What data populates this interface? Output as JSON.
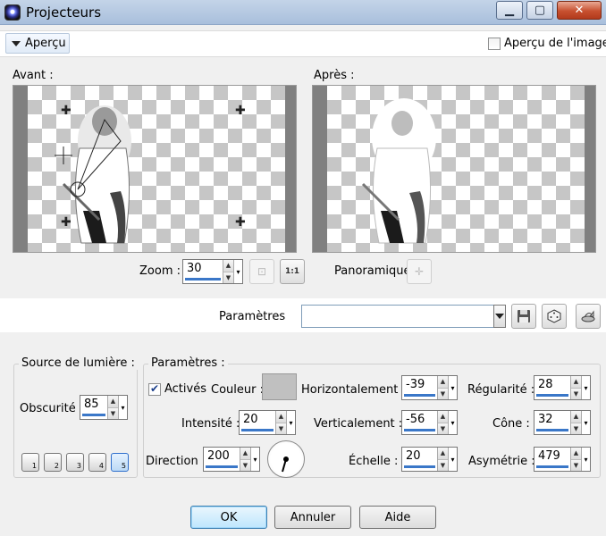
{
  "window": {
    "title": "Projecteurs",
    "minimize_glyph": "▁",
    "maximize_glyph": "▢",
    "close_glyph": "✕"
  },
  "preview": {
    "toggle_label": "Aperçu",
    "image_preview_label": "Aperçu de l'image",
    "image_preview_checked": false,
    "before_label": "Avant :",
    "after_label": "Après :",
    "zoom_label": "Zoom :",
    "zoom_value": "30",
    "zoom_fit_icon": "fit-to-window-icon",
    "zoom_fit_glyph": "⊡",
    "zoom_1to1_label": "1:1",
    "pan_label": "Panoramique",
    "pan_glyph": "✛",
    "handle_glyph": "✚"
  },
  "presets": {
    "label": "Paramètres",
    "value": "",
    "save_icon": "floppy-disk-icon",
    "random_icon": "dice-icon",
    "reset_icon": "reset-icon"
  },
  "light_source": {
    "group_title": "Source de lumière :",
    "darkness_label": "Obscurité :",
    "darkness_value": "85",
    "lights": [
      {
        "label": "1",
        "selected": false
      },
      {
        "label": "2",
        "selected": false
      },
      {
        "label": "3",
        "selected": false
      },
      {
        "label": "4",
        "selected": false
      },
      {
        "label": "5",
        "selected": true
      }
    ]
  },
  "params": {
    "group_title": "Paramètres :",
    "active_label": "Activés",
    "active_checked": true,
    "color_label": "Couleur :",
    "color_value": "#c0c0c0",
    "intensity_label": "Intensité :",
    "intensity_value": "20",
    "direction_label": "Direction :",
    "direction_value": "200",
    "horizontal_label": "Horizontalement :",
    "horizontal_value": "-39",
    "vertical_label": "Verticalement :",
    "vertical_value": "-56",
    "scale_label": "Échelle :",
    "scale_value": "20",
    "regularity_label": "Régularité :",
    "regularity_value": "28",
    "cone_label": "Cône :",
    "cone_value": "32",
    "asymmetry_label": "Asymétrie :",
    "asymmetry_value": "479"
  },
  "buttons": {
    "ok": "OK",
    "cancel": "Annuler",
    "help": "Aide"
  },
  "colors": {
    "accent": "#3a77c8",
    "titlebar": "#b6c8e0",
    "close_button": "#c7502f"
  }
}
